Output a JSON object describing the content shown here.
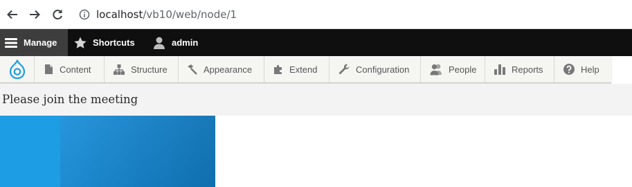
{
  "browser": {
    "url_host": "localhost",
    "url_path": "/vb10/web/node/1"
  },
  "toolbar": {
    "manage_label": "Manage",
    "shortcuts_label": "Shortcuts",
    "user_label": "admin"
  },
  "admin_menu": {
    "items": [
      {
        "label": "Content",
        "icon": "content-icon"
      },
      {
        "label": "Structure",
        "icon": "structure-icon"
      },
      {
        "label": "Appearance",
        "icon": "appearance-icon"
      },
      {
        "label": "Extend",
        "icon": "extend-icon"
      },
      {
        "label": "Configuration",
        "icon": "configuration-icon"
      },
      {
        "label": "People",
        "icon": "people-icon"
      },
      {
        "label": "Reports",
        "icon": "reports-icon"
      },
      {
        "label": "Help",
        "icon": "help-icon"
      }
    ]
  },
  "page": {
    "title": "Please join the meeting"
  },
  "colors": {
    "drupal_blue": "#1d9de4",
    "toolbar_black": "#0f0f0f",
    "manage_active": "#3d3d3d",
    "tray_bg": "#f5f5f2"
  }
}
